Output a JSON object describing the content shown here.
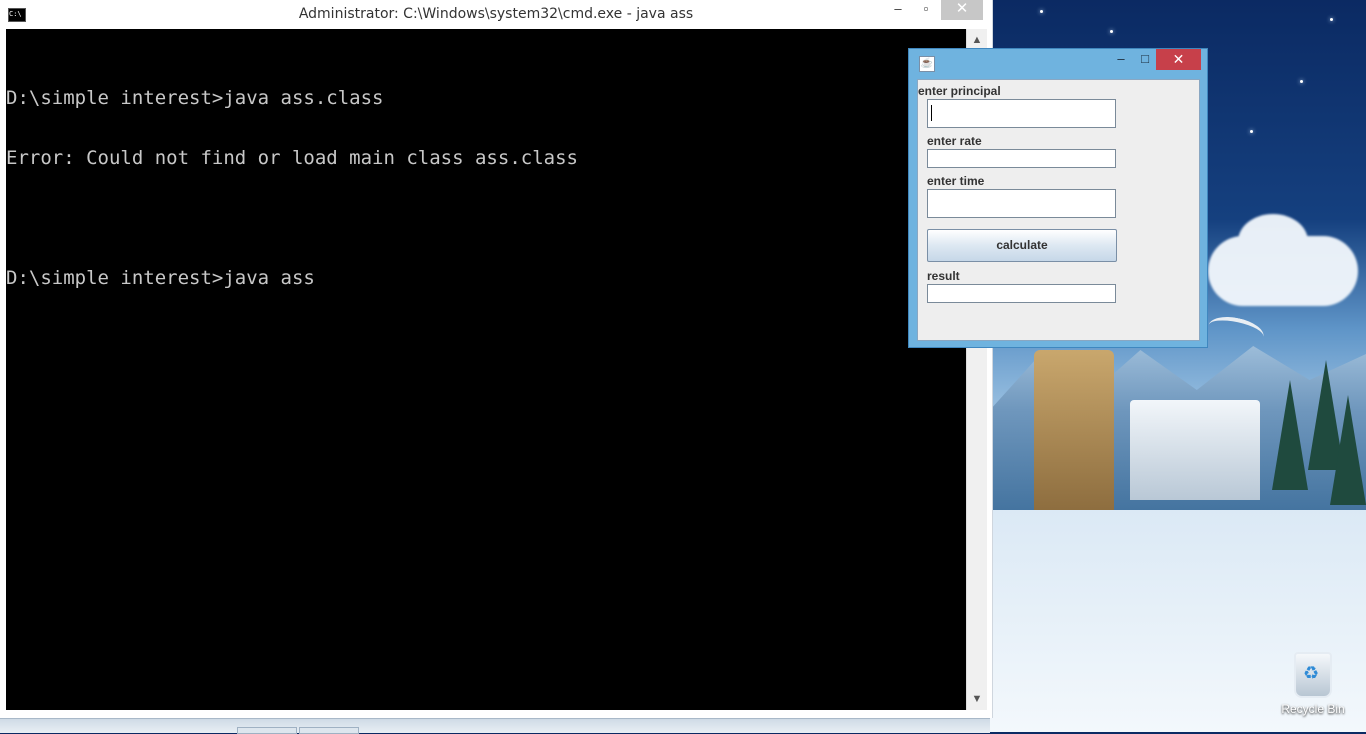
{
  "cmd": {
    "title": "Administrator: C:\\Windows\\system32\\cmd.exe - java  ass",
    "icon_label": "C:\\",
    "buttons": {
      "minimize": "–",
      "maximize": "▫",
      "close": "✕"
    },
    "lines": [
      "D:\\simple interest>java ass.class",
      "Error: Could not find or load main class ass.class",
      "",
      "D:\\simple interest>java ass"
    ],
    "scroll": {
      "up": "▲",
      "down": "▼"
    }
  },
  "java_window": {
    "title": "",
    "icon_label": "☕",
    "buttons": {
      "minimize": "–",
      "maximize": "□",
      "close": "✕"
    },
    "principal_label": "enter principal",
    "principal_value": "",
    "rate_label": "enter rate",
    "rate_value": "",
    "time_label": "enter time",
    "time_value": "",
    "calculate_label": "calculate",
    "result_label": "result",
    "result_value": ""
  },
  "desktop": {
    "recycle_bin_label": "Recycle Bin",
    "icons": [
      "recycle-bin-icon"
    ]
  }
}
